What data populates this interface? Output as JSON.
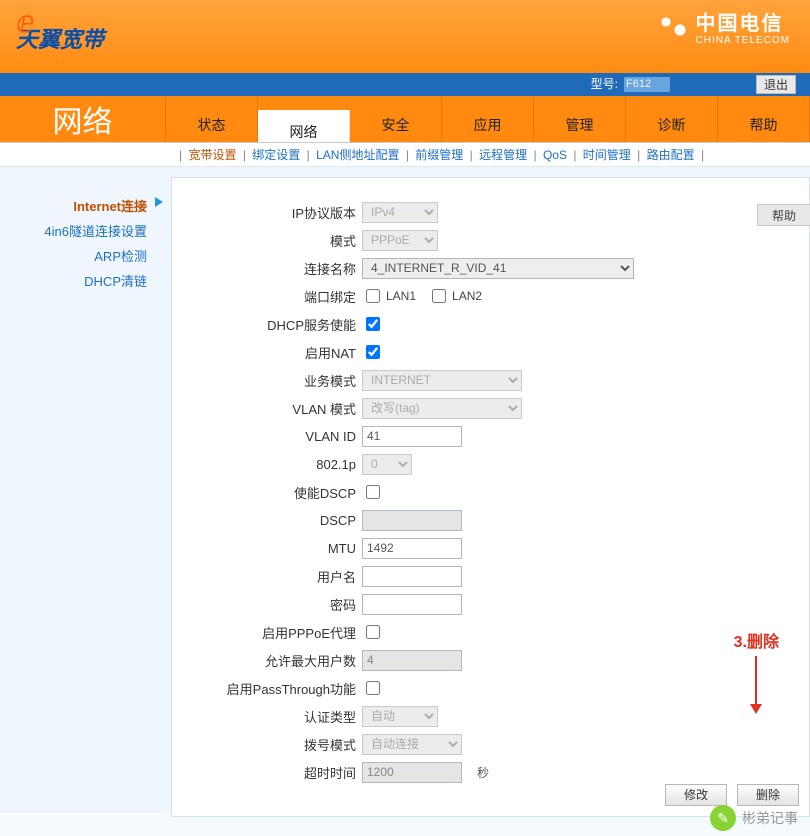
{
  "brand": {
    "bb_text": "天翼宽带",
    "ct_name": "中国电信",
    "ct_en": "CHINA TELECOM"
  },
  "modelbar": {
    "label": "型号:",
    "value": "F612",
    "exit": "退出"
  },
  "page_title": "网络",
  "tabs": {
    "t0": "状态",
    "t1": "网络",
    "t2": "安全",
    "t3": "应用",
    "t4": "管理",
    "t5": "诊断",
    "t6": "帮助"
  },
  "subnav": {
    "s0": "宽带设置",
    "s1": "绑定设置",
    "s2": "LAN侧地址配置",
    "s3": "前缀管理",
    "s4": "远程管理",
    "s5": "QoS",
    "s6": "时间管理",
    "s7": "路由配置"
  },
  "sidebar": {
    "i0": "Internet连接",
    "i1": "4in6隧道连接设置",
    "i2": "ARP检测",
    "i3": "DHCP清链"
  },
  "help_chip": "帮助",
  "form": {
    "ip_ver_lbl": "IP协议版本",
    "ip_ver_val": "IPv4",
    "mode_lbl": "模式",
    "mode_val": "PPPoE",
    "conn_lbl": "连接名称",
    "conn_val": "4_INTERNET_R_VID_41",
    "portbind_lbl": "端口绑定",
    "lan1": "LAN1",
    "lan2": "LAN2",
    "dhcp_srv_lbl": "DHCP服务使能",
    "nat_lbl": "启用NAT",
    "svc_mode_lbl": "业务模式",
    "svc_mode_val": "INTERNET",
    "vlan_mode_lbl": "VLAN 模式",
    "vlan_mode_val": "改写(tag)",
    "vlan_id_lbl": "VLAN ID",
    "vlan_id_val": "41",
    "p8021_lbl": "802.1p",
    "p8021_val": "0",
    "dscp_en_lbl": "使能DSCP",
    "dscp_lbl": "DSCP",
    "dscp_val": "",
    "mtu_lbl": "MTU",
    "mtu_val": "1492",
    "user_lbl": "用户名",
    "user_val": "",
    "pass_lbl": "密码",
    "pass_val": "",
    "pppoe_proxy_lbl": "启用PPPoE代理",
    "maxuser_lbl": "允许最大用户数",
    "maxuser_val": "4",
    "pt_lbl": "启用PassThrough功能",
    "auth_lbl": "认证类型",
    "auth_val": "自动",
    "dial_lbl": "拨号模式",
    "dial_val": "自动连接",
    "timeout_lbl": "超时时间",
    "timeout_val": "1200",
    "timeout_suffix": "秒"
  },
  "buttons": {
    "modify": "修改",
    "delete": "删除"
  },
  "annotation": "3.删除",
  "watermark": "彬弟记事"
}
